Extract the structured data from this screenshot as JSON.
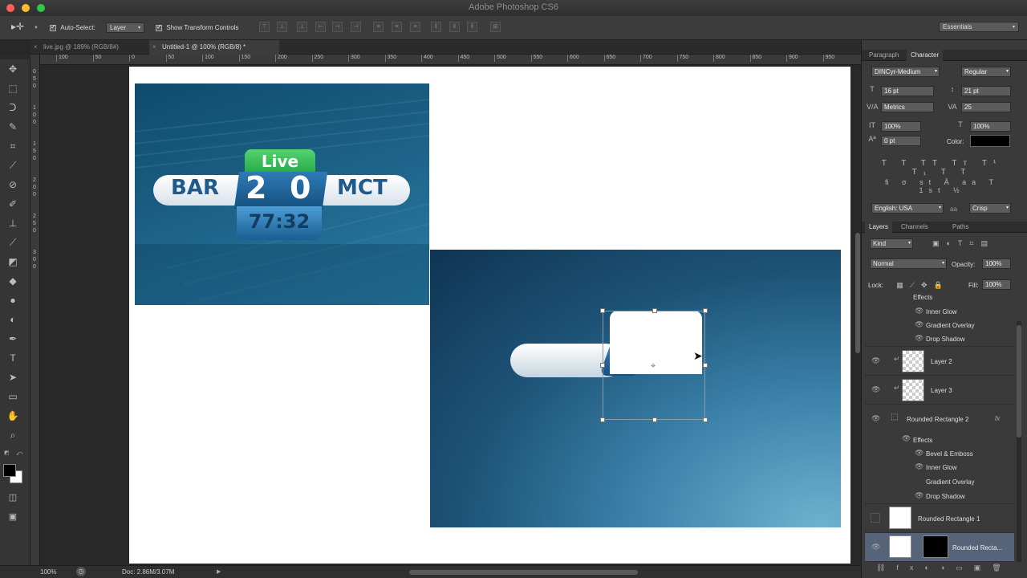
{
  "app": {
    "title": "Adobe Photoshop CS6"
  },
  "options": {
    "auto_select_label": "Auto-Select:",
    "auto_select_value": "Layer",
    "show_transform_label": "Show Transform Controls",
    "workspace": "Essentials"
  },
  "tabs": [
    {
      "label": "live.jpg @ 189% (RGB/8#)"
    },
    {
      "label": "Untitled-1 @ 100% (RGB/8) *"
    }
  ],
  "ruler": {
    "h_ticks": [
      "100",
      "50",
      "0",
      "50",
      "100",
      "150",
      "200",
      "250",
      "300",
      "350",
      "400",
      "450",
      "500",
      "550",
      "600",
      "650",
      "700",
      "750",
      "800",
      "850",
      "900",
      "950"
    ],
    "v_ticks": [
      "0",
      "5",
      "0",
      "1",
      "0",
      "0",
      "1",
      "5",
      "0",
      "2",
      "0",
      "0",
      "2",
      "5",
      "0",
      "3",
      "0",
      "0"
    ]
  },
  "thumbnail": {
    "live": "Live",
    "team_left": "BAR",
    "score_left": "2",
    "score_right": "0",
    "team_right": "MCT",
    "time": "77:32"
  },
  "character": {
    "tab_paragraph": "Paragraph",
    "tab_character": "Character",
    "font_family": "DINCyr-Medium",
    "font_style": "Regular",
    "font_size": "16 pt",
    "leading": "21 pt",
    "kerning": "Metrics",
    "tracking": "25",
    "vscale": "100%",
    "hscale": "100%",
    "baseline": "0 pt",
    "color_label": "Color:",
    "text_color": "#000000",
    "language": "English: USA",
    "aa_label": "aa",
    "antialias": "Crisp"
  },
  "layers_panel": {
    "tab_layers": "Layers",
    "tab_channels": "Channels",
    "tab_paths": "Paths",
    "kind": "Kind",
    "blend": "Normal",
    "opacity_label": "Opacity:",
    "opacity": "100%",
    "lock_label": "Lock:",
    "fill_label": "Fill:",
    "fill": "100%",
    "top_effects_label": "Effects",
    "top_effects": [
      "Inner Glow",
      "Gradient Overlay",
      "Drop Shadow"
    ],
    "layer2": "Layer 2",
    "layer3": "Layer 3",
    "rr2": "Rounded Rectangle 2",
    "fx": "fx",
    "effects_label": "Effects",
    "effects": [
      "Bevel & Emboss",
      "Inner Glow",
      "Gradient Overlay",
      "Drop Shadow"
    ],
    "rr1": "Rounded Rectangle 1",
    "rr_sel": "Rounded Recta..."
  },
  "status": {
    "zoom": "100%",
    "doc": "Doc: 2.86M/3.07M"
  },
  "colors": {
    "live_green": "#2fb84e",
    "score_blue": "#1d5f9b",
    "selection": "#56647a"
  }
}
